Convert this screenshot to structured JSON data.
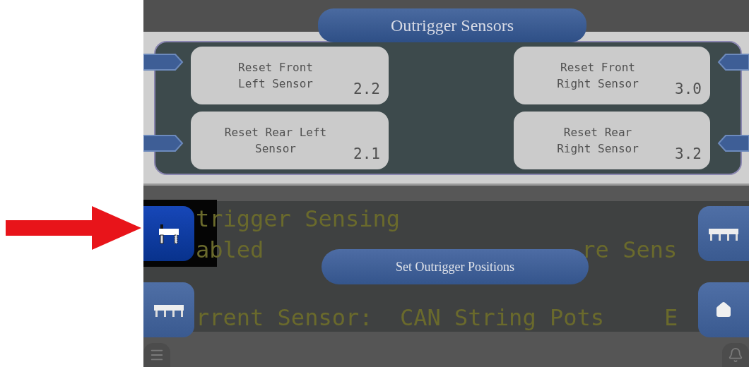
{
  "modal": {
    "title": "Outrigger Sensors",
    "sensors": [
      {
        "label": "Reset Front\nLeft Sensor",
        "value": "2.2"
      },
      {
        "label": "Reset Front\nRight Sensor",
        "value": "3.0"
      },
      {
        "label": "Reset Rear Left\nSensor",
        "value": "2.1"
      },
      {
        "label": "Reset Rear\nRight Sensor",
        "value": "3.2"
      }
    ]
  },
  "background_panel": {
    "line_1": "trigger Sensing",
    "line_2": "abled",
    "line_2_right": "re Sens",
    "line_3": "rrent Sensor:  CAN String Pots",
    "line_3_end": "E"
  },
  "set_positions_button": "Set Outrigger Positions",
  "side_buttons": [
    {
      "kind": "outrigger",
      "selected": true
    },
    {
      "kind": "outrigger-row",
      "selected": false
    },
    {
      "kind": "outrigger-row",
      "selected": false
    },
    {
      "kind": "home",
      "selected": false
    }
  ]
}
